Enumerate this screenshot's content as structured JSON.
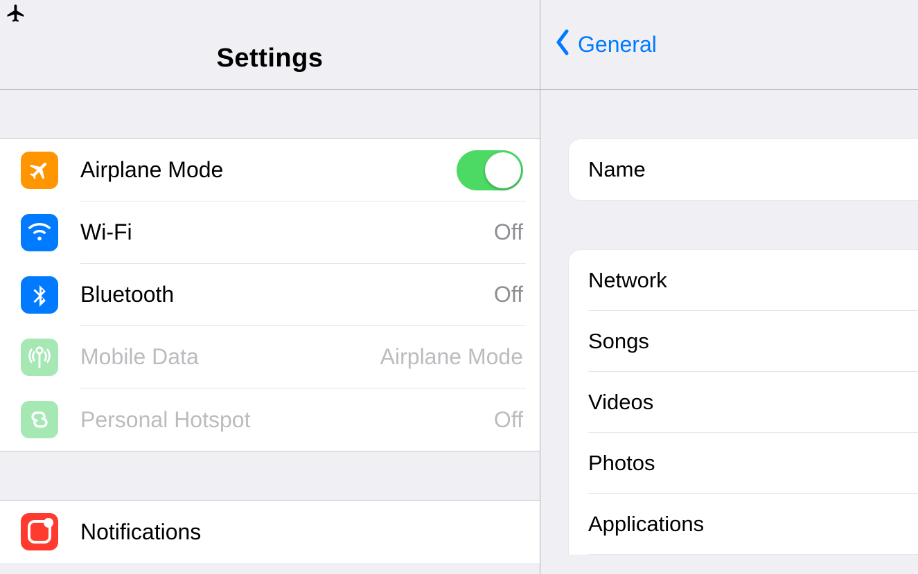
{
  "status": {
    "airplane_on": true
  },
  "left": {
    "title": "Settings",
    "group1": [
      {
        "key": "airplane",
        "label": "Airplane Mode",
        "value": null,
        "toggle": true,
        "toggle_on": true,
        "disabled": false
      },
      {
        "key": "wifi",
        "label": "Wi-Fi",
        "value": "Off",
        "toggle": false,
        "disabled": false
      },
      {
        "key": "bluetooth",
        "label": "Bluetooth",
        "value": "Off",
        "toggle": false,
        "disabled": false
      },
      {
        "key": "mobiledata",
        "label": "Mobile Data",
        "value": "Airplane Mode",
        "toggle": false,
        "disabled": true
      },
      {
        "key": "hotspot",
        "label": "Personal Hotspot",
        "value": "Off",
        "toggle": false,
        "disabled": true
      }
    ],
    "group2": [
      {
        "key": "notifications",
        "label": "Notifications",
        "value": null,
        "toggle": false,
        "disabled": false
      }
    ]
  },
  "right": {
    "back_label": "General",
    "group1": [
      {
        "key": "name",
        "label": "Name"
      }
    ],
    "group2": [
      {
        "key": "network",
        "label": "Network"
      },
      {
        "key": "songs",
        "label": "Songs"
      },
      {
        "key": "videos",
        "label": "Videos"
      },
      {
        "key": "photos",
        "label": "Photos"
      },
      {
        "key": "applications",
        "label": "Applications"
      }
    ]
  }
}
